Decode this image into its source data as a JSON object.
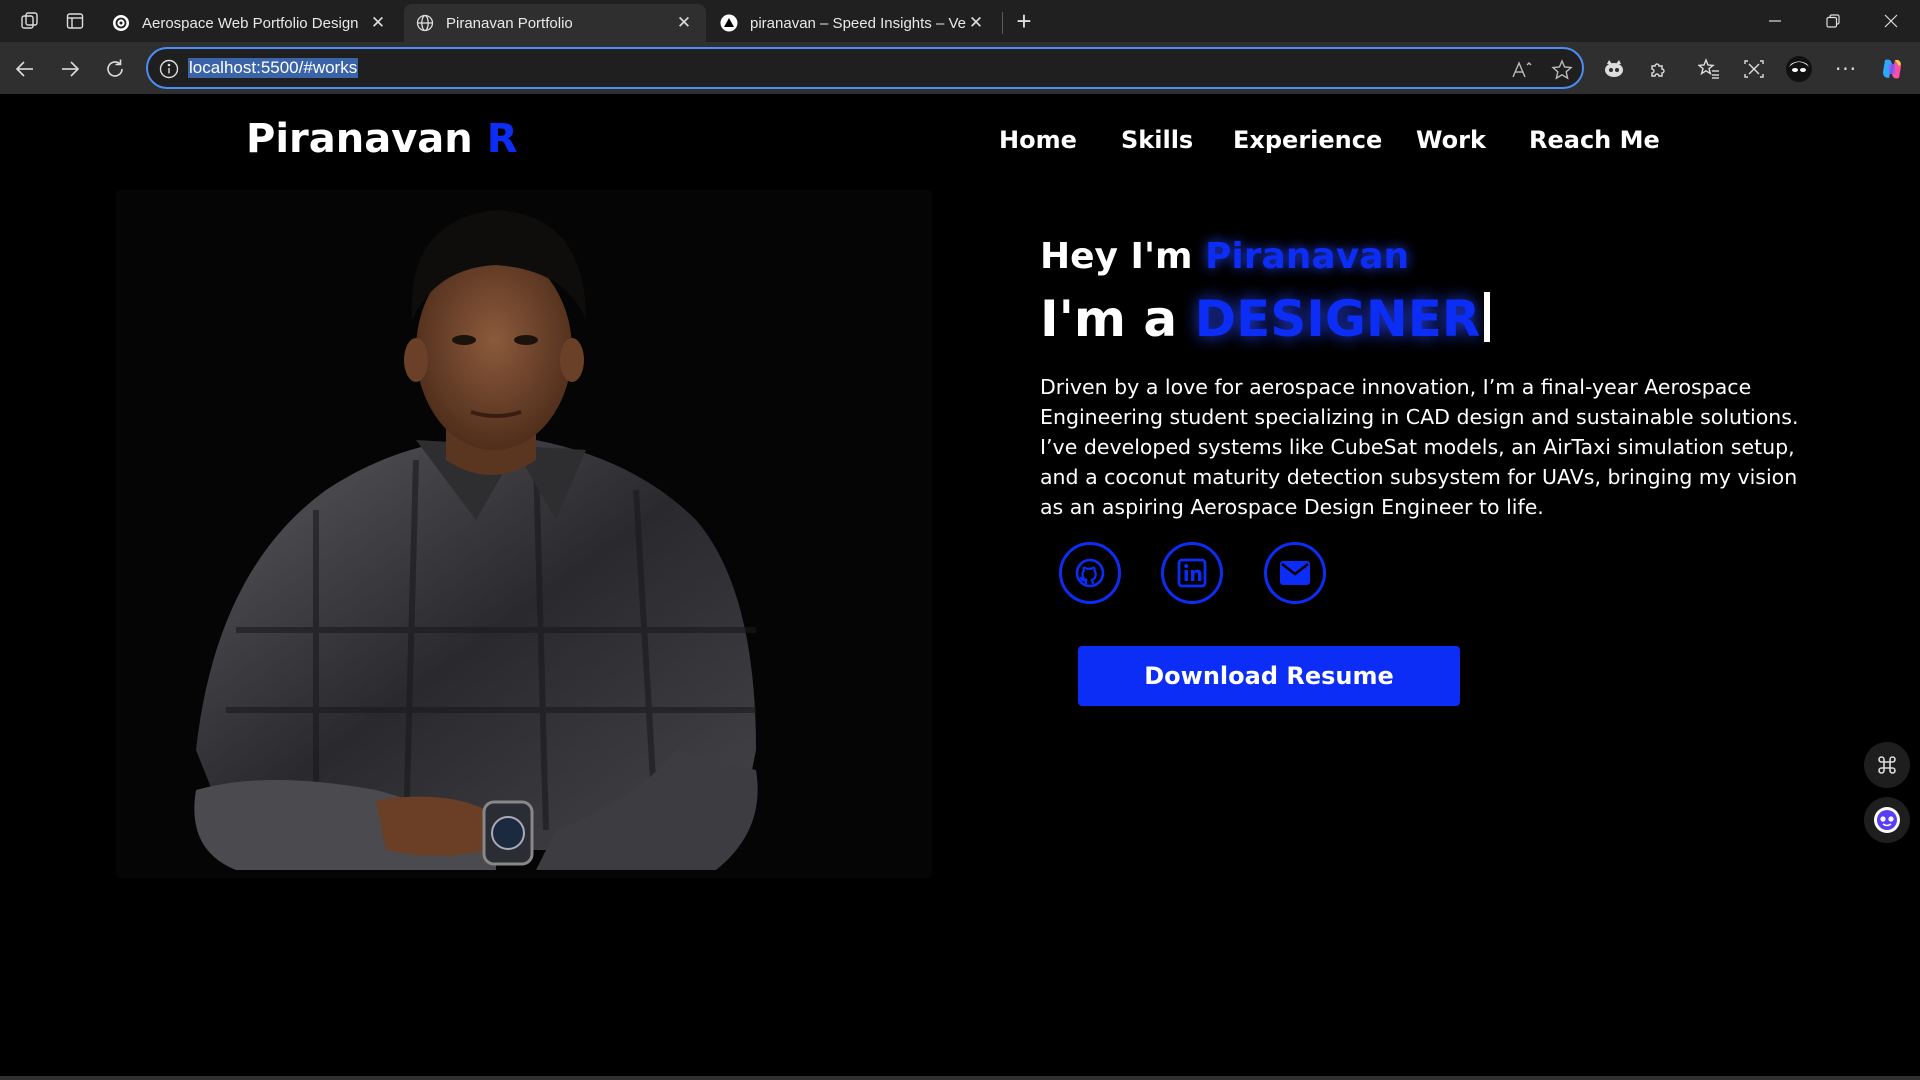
{
  "browser": {
    "tabs": [
      {
        "title": "Aerospace Web Portfolio Design",
        "icon": "openai-icon",
        "active": false
      },
      {
        "title": "Piranavan Portfolio",
        "icon": "globe-icon",
        "active": true
      },
      {
        "title": "piranavan – Speed Insights – Verc",
        "icon": "vercel-triangle-icon",
        "active": false
      }
    ],
    "new_tab_label": "+",
    "url": "localhost:5500/#works"
  },
  "site": {
    "logo_name": "Piranavan",
    "logo_accent": "R",
    "menu": [
      "Home",
      "Skills",
      "Experience",
      "Work",
      "Reach Me"
    ],
    "hero": {
      "greeting": "Hey I'm",
      "greeting_name": "Piranavan",
      "role_prefix": "I'm a",
      "role": "DESIGNER",
      "bio": "Driven by a love for aerospace innovation, I’m a final-year Aerospace Engineering student specializing in CAD design and sustainable solutions. I’ve developed systems like CubeSat models, an AirTaxi simulation setup, and a coconut maturity detection subsystem for UAVs, bringing my vision as an aspiring Aerospace Design Engineer to life.",
      "social": [
        "github-icon",
        "linkedin-icon",
        "email-icon"
      ],
      "resume_button": "Download Resume"
    }
  },
  "colors": {
    "accent": "#0b2df5",
    "background": "#000000",
    "text": "#ffffff"
  }
}
